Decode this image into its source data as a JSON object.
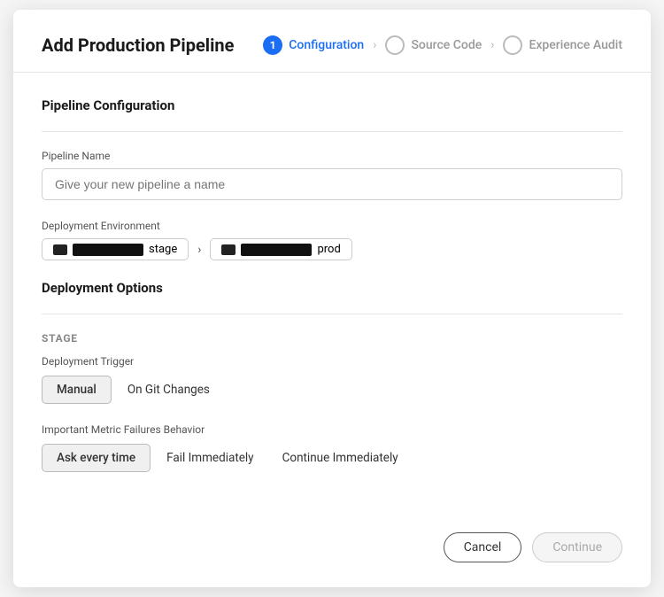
{
  "modal": {
    "title": "Add Production Pipeline"
  },
  "stepper": {
    "steps": [
      {
        "id": "configuration",
        "label": "Configuration",
        "number": "1",
        "active": true
      },
      {
        "id": "source-code",
        "label": "Source Code",
        "active": false
      },
      {
        "id": "experience-audit",
        "label": "Experience Audit",
        "active": false
      }
    ]
  },
  "pipeline_config": {
    "section_title": "Pipeline Configuration",
    "pipeline_name": {
      "label": "Pipeline Name",
      "placeholder": "Give your new pipeline a name"
    },
    "deployment_env": {
      "label": "Deployment Environment",
      "from_label": "stage",
      "to_label": "prod"
    }
  },
  "deployment_options": {
    "section_title": "Deployment Options",
    "stage_label": "STAGE",
    "deployment_trigger": {
      "label": "Deployment Trigger",
      "options": [
        {
          "id": "manual",
          "label": "Manual",
          "selected": true
        },
        {
          "id": "on-git-changes",
          "label": "On Git Changes",
          "selected": false
        }
      ]
    },
    "metric_failures": {
      "label": "Important Metric Failures Behavior",
      "options": [
        {
          "id": "ask-every-time",
          "label": "Ask every time",
          "selected": true
        },
        {
          "id": "fail-immediately",
          "label": "Fail Immediately",
          "selected": false
        },
        {
          "id": "continue-immediately",
          "label": "Continue Immediately",
          "selected": false
        }
      ]
    }
  },
  "footer": {
    "cancel_label": "Cancel",
    "continue_label": "Continue"
  }
}
